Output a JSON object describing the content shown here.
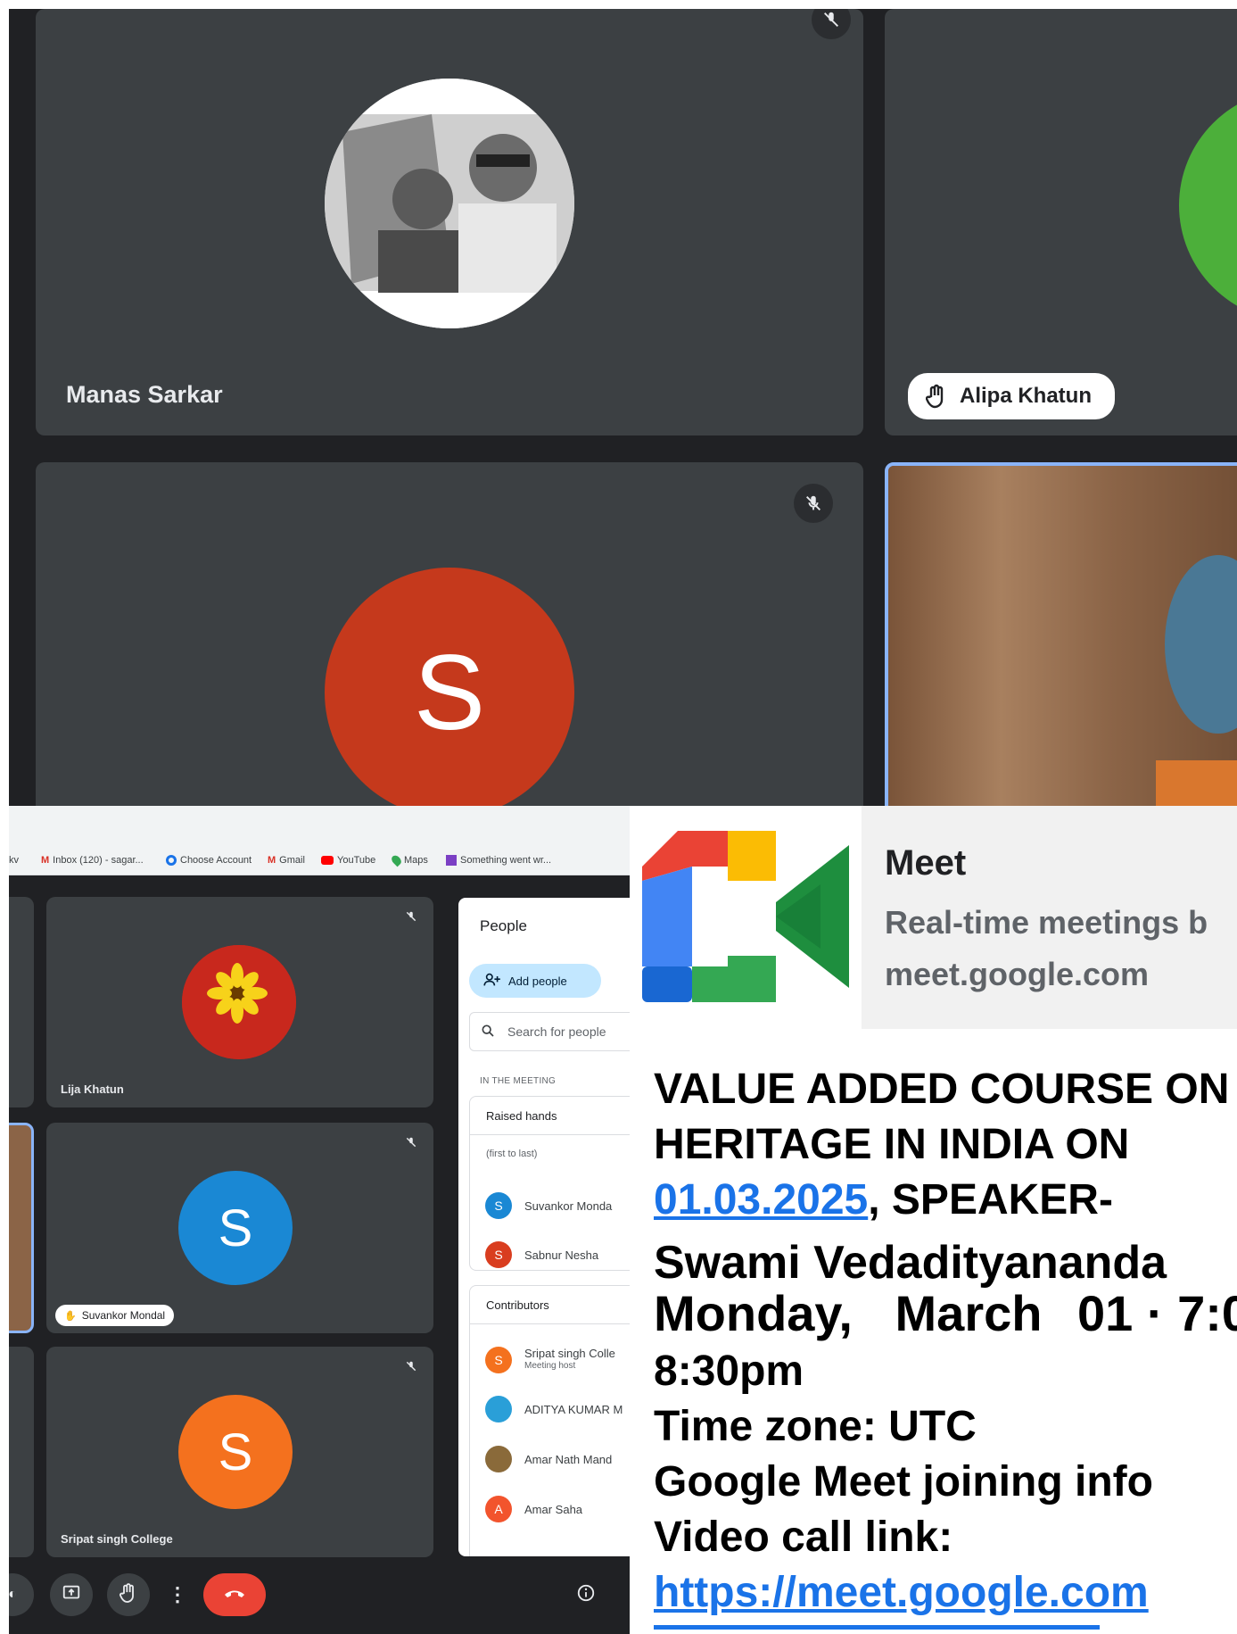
{
  "top_tiles": {
    "manas": {
      "name": "Manas Sarkar"
    },
    "alipa": {
      "name": "Alipa Khatun"
    },
    "s_red": {
      "letter": "S",
      "color": "#c5391c"
    },
    "alipa_avatar_color": "#4caf3a"
  },
  "bookmarks": [
    {
      "icon": "gmail-icon",
      "label": "Inbox (120) - sagar..."
    },
    {
      "icon": "chrome-icon",
      "label": "Choose Account"
    },
    {
      "icon": "gmail-icon",
      "label": "Gmail"
    },
    {
      "icon": "youtube-icon",
      "label": "YouTube"
    },
    {
      "icon": "maps-icon",
      "label": "Maps"
    },
    {
      "icon": "page-icon",
      "label": "Something went wr..."
    }
  ],
  "small_tiles": {
    "lija": {
      "name": "Lija Khatun"
    },
    "suvankor": {
      "name": "Suvankor Mondal",
      "letter": "S",
      "color": "#1a88d4"
    },
    "sripat": {
      "name": "Sripat singh College",
      "letter": "S",
      "color": "#f4711e"
    }
  },
  "people_panel": {
    "title": "People",
    "add_people": "Add people",
    "search_placeholder": "Search for people",
    "in_meeting": "IN THE MEETING",
    "raised_hands": "Raised hands",
    "first_to_last": "(first to last)",
    "raised": [
      {
        "letter": "S",
        "name": "Suvankor Monda",
        "color": "#1a88d4"
      },
      {
        "letter": "S",
        "name": "Sabnur Nesha",
        "color": "#d93d1f"
      }
    ],
    "contributors": "Contributors",
    "contributors_list": [
      {
        "letter": "S",
        "name": "Sripat singh Colle",
        "sub": "Meeting host",
        "color": "#f4711e"
      },
      {
        "letter": "",
        "name": "ADITYA KUMAR M",
        "sub": "",
        "color": "#2a9fd8"
      },
      {
        "letter": "",
        "name": "Amar Nath Mand",
        "sub": "",
        "color": "#8a6a3a"
      },
      {
        "letter": "A",
        "name": "Amar Saha",
        "sub": "",
        "color": "#f2542d"
      }
    ]
  },
  "meet_card": {
    "title": "Meet",
    "subtitle": "Real-time meetings b",
    "domain": "meet.google.com"
  },
  "message": {
    "line1": "VALUE ADDED COURSE ON",
    "line2": "HERITAGE IN INDIA ON",
    "date": "01.03.2025",
    "line3_rest": ", SPEAKER-",
    "line4": "Swami Vedadityananda",
    "line5a": "Monday,",
    "line5b": "March",
    "line5c": "01 · 7:0",
    "line6": "8:30pm",
    "line7": "Time zone: UTC",
    "line8": "Google Meet joining info",
    "line9": "Video call link:",
    "link": "https://meet.google.com"
  }
}
